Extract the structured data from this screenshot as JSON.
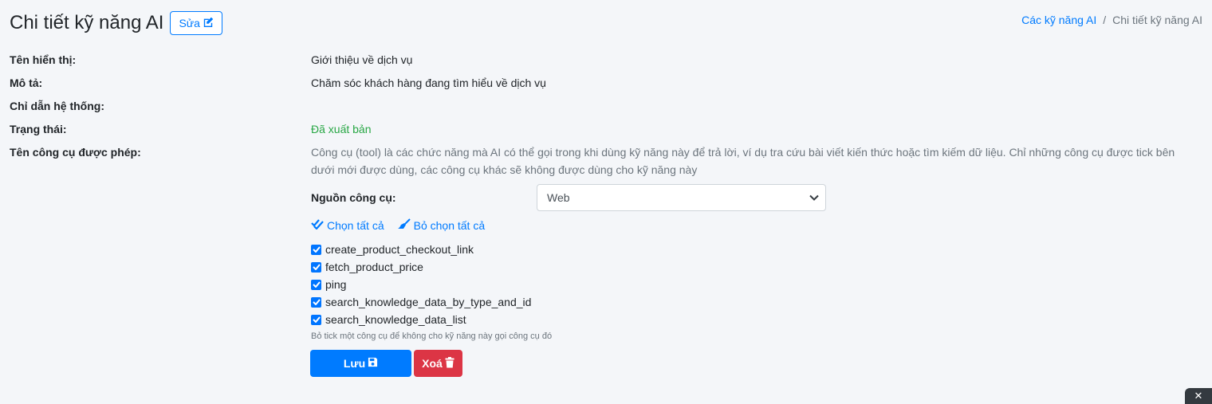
{
  "header": {
    "title": "Chi tiết kỹ năng AI",
    "edit_label": "Sửa"
  },
  "breadcrumb": {
    "parent": "Các kỹ năng AI",
    "separator": "/",
    "current": "Chi tiết kỹ năng AI"
  },
  "fields": {
    "display_name": {
      "label": "Tên hiển thị:",
      "value": "Giới thiệu về dịch vụ"
    },
    "description": {
      "label": "Mô tả:",
      "value": "Chăm sóc khách hàng đang tìm hiểu về dịch vụ"
    },
    "system_prompt": {
      "label": "Chỉ dẫn hệ thống:",
      "value": ""
    },
    "status": {
      "label": "Trạng thái:",
      "value": "Đã xuất bản"
    },
    "allowed_tools": {
      "label": "Tên công cụ được phép:",
      "description": "Công cụ (tool) là các chức năng mà AI có thể gọi trong khi dùng kỹ năng này để trả lời, ví dụ tra cứu bài viết kiến thức hoặc tìm kiếm dữ liệu. Chỉ những công cụ được tick bên dưới mới được dùng, các công cụ khác sẽ không được dùng cho kỹ năng này"
    }
  },
  "tool_source": {
    "label": "Nguồn công cụ:",
    "selected": "Web"
  },
  "actions": {
    "select_all": "Chọn tất cả",
    "deselect_all": "Bỏ chọn tất cả"
  },
  "tools": [
    {
      "name": "create_product_checkout_link",
      "checked": true
    },
    {
      "name": "fetch_product_price",
      "checked": true
    },
    {
      "name": "ping",
      "checked": true
    },
    {
      "name": "search_knowledge_data_by_type_and_id",
      "checked": true
    },
    {
      "name": "search_knowledge_data_list",
      "checked": true
    }
  ],
  "hint": "Bỏ tick một công cụ để không cho kỹ năng này gọi công cụ đó",
  "buttons": {
    "save": "Lưu",
    "delete": "Xoá"
  },
  "colors": {
    "primary": "#007bff",
    "danger": "#dc3545",
    "success": "#28a745"
  }
}
